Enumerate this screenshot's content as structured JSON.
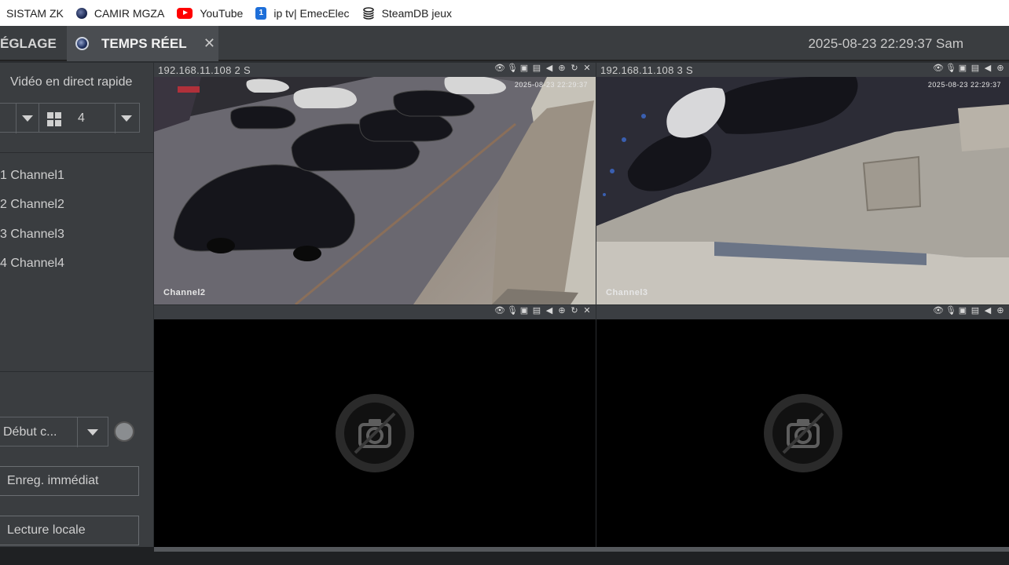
{
  "bookmarks": [
    {
      "label": "SISTAM ZK",
      "icon": "none"
    },
    {
      "label": "CAMIR MGZA",
      "icon": "camera-globe-icon"
    },
    {
      "label": "YouTube",
      "icon": "youtube-icon"
    },
    {
      "label": "ip tv| EmecElec",
      "icon": "iptv-icon"
    },
    {
      "label": "SteamDB jeux",
      "icon": "steamdb-icon"
    }
  ],
  "tabs": {
    "reglage": "ÉGLAGE",
    "live": "TEMPS RÉEL",
    "live_close": "✕"
  },
  "datetime": "2025-08-23 22:29:37 Sam",
  "sidebar": {
    "title": "Vidéo en direct rapide",
    "layout_value": "4",
    "channels": [
      "1 Channel1",
      "2 Channel2",
      "3 Channel3",
      "4 Channel4"
    ],
    "record_select": "Début c...",
    "instant_record": "Enreg. immédiat",
    "local_playback": "Lecture locale"
  },
  "panes": [
    {
      "label": "192.168.11.108   2   S",
      "channel": "Channel2",
      "timestamp": "2025-08-23 22:29:37",
      "state": "live"
    },
    {
      "label": "192.168.11.108   3   S",
      "channel": "Channel3",
      "timestamp": "2025-08-23 22:29:37",
      "state": "live"
    },
    {
      "label": "",
      "channel": "",
      "timestamp": "",
      "state": "no-video"
    },
    {
      "label": "",
      "channel": "",
      "timestamp": "",
      "state": "no-video"
    }
  ],
  "pane_icons": [
    "eye-icon",
    "microphone-icon",
    "snapshot-icon",
    "record-icon",
    "speaker-icon",
    "zoom-icon",
    "refresh-icon",
    "close-icon"
  ],
  "colors": {
    "background": "#2b2e31",
    "panel": "#3a3d40",
    "active_tab": "#4a4d51",
    "text": "#cfcfcf"
  }
}
